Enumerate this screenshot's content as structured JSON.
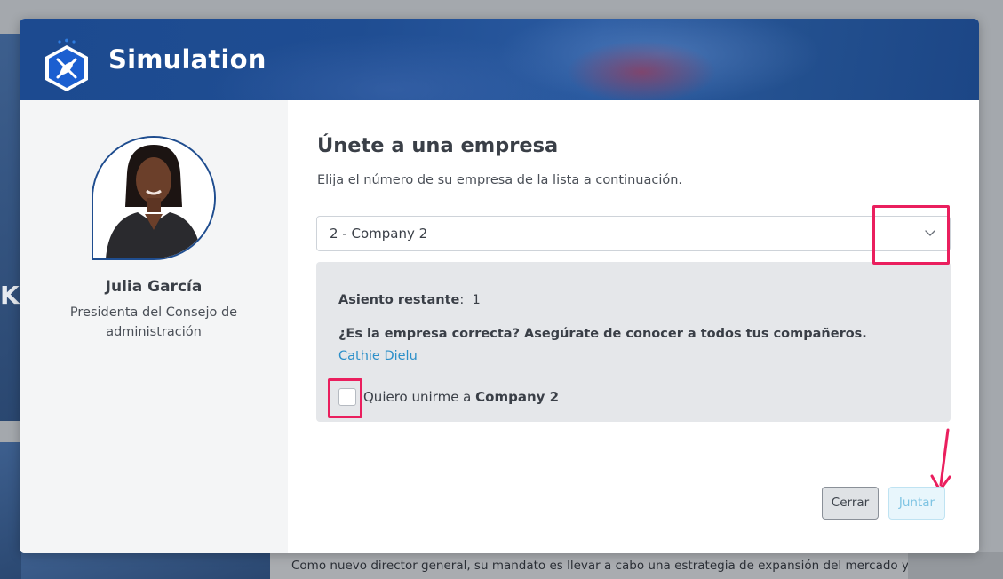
{
  "app": {
    "title": "Simulation",
    "logo_icon": "kayak-hexagon-logo"
  },
  "background": {
    "partial_heading": "Ka",
    "intro_text": "Como nuevo director general, su mandato es llevar a cabo una estrategia de expansión del mercado y"
  },
  "user": {
    "name": "Julia García",
    "role": "Presidenta del Consejo de administración"
  },
  "join_form": {
    "title": "Únete a una empresa",
    "subtitle": "Elija el número de su empresa de la lista a continuación.",
    "selected_company": "2 - Company 2",
    "seats_label": "Asiento restante",
    "seats_value": "1",
    "question": "¿Es la empresa correcta? Asegúrate de conocer a todos tus compañeros.",
    "members": [
      "Cathie Dielu"
    ],
    "confirm_prefix": "Quiero unirme a",
    "confirm_company": "Company 2",
    "confirm_checked": false
  },
  "buttons": {
    "close": "Cerrar",
    "join": "Juntar"
  },
  "colors": {
    "header": "#1f4d92",
    "highlight": "#ea1f5e",
    "link": "#2b8fc9",
    "join_disabled": "#7ec4e3"
  }
}
